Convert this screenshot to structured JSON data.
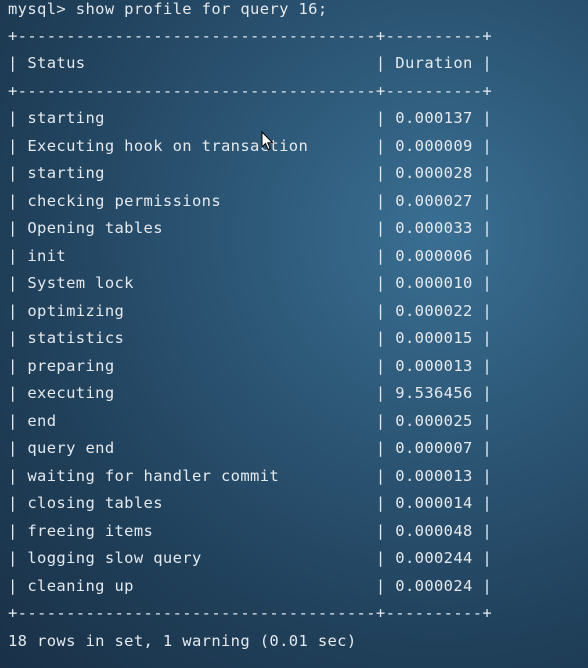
{
  "terminal": {
    "command_line": "mysql> show profile for query 16;",
    "border_line": "+-------------------------------------+----------+",
    "header": "| Status                              | Duration |",
    "rows": [
      "| starting                            | 0.000137 |",
      "| Executing hook on transaction       | 0.000009 |",
      "| starting                            | 0.000028 |",
      "| checking permissions                | 0.000027 |",
      "| Opening tables                      | 0.000033 |",
      "| init                                | 0.000006 |",
      "| System lock                         | 0.000010 |",
      "| optimizing                          | 0.000022 |",
      "| statistics                          | 0.000015 |",
      "| preparing                           | 0.000013 |",
      "| executing                           | 9.536456 |",
      "| end                                 | 0.000025 |",
      "| query end                           | 0.000007 |",
      "| waiting for handler commit          | 0.000013 |",
      "| closing tables                      | 0.000014 |",
      "| freeing items                       | 0.000048 |",
      "| logging slow query                  | 0.000244 |",
      "| cleaning up                         | 0.000024 |"
    ],
    "footer": "18 rows in set, 1 warning (0.01 sec)"
  },
  "cursor_icon": "mouse-pointer-icon"
}
